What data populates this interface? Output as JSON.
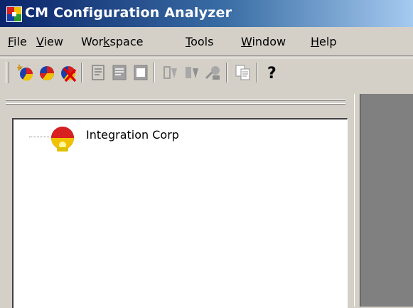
{
  "window": {
    "title": "CM Configuration Analyzer",
    "icon": "app-icon"
  },
  "menu": {
    "items": [
      {
        "mnemonic": "F",
        "rest": "ile"
      },
      {
        "mnemonic": "V",
        "rest": "iew"
      },
      {
        "pre": "Wor",
        "mnemonic": "k",
        "rest": "space"
      },
      {
        "mnemonic": "T",
        "rest": "ools"
      },
      {
        "mnemonic": "W",
        "rest": "indow"
      },
      {
        "mnemonic": "H",
        "rest": "elp"
      }
    ]
  },
  "toolbar": {
    "buttons": [
      {
        "icon": "new-workspace-icon",
        "enabled": true
      },
      {
        "icon": "open-workspace-icon",
        "enabled": true
      },
      {
        "icon": "delete-workspace-icon",
        "enabled": true
      },
      {
        "icon": "document-1-icon",
        "enabled": false
      },
      {
        "icon": "document-2-icon",
        "enabled": false
      },
      {
        "icon": "document-3-icon",
        "enabled": false
      },
      {
        "icon": "component-1-icon",
        "enabled": false
      },
      {
        "icon": "component-2-icon",
        "enabled": false
      },
      {
        "icon": "component-3-icon",
        "enabled": false
      },
      {
        "icon": "copy-icon",
        "enabled": false
      },
      {
        "icon": "help-icon",
        "enabled": true
      }
    ]
  },
  "tree": {
    "nodes": [
      {
        "label": "Integration Corp",
        "icon": "organization-pie-icon"
      }
    ]
  },
  "colors": {
    "title_start": "#0a246a",
    "title_end": "#a6caf0",
    "face": "#d4d0c8",
    "workspace": "#808080"
  }
}
